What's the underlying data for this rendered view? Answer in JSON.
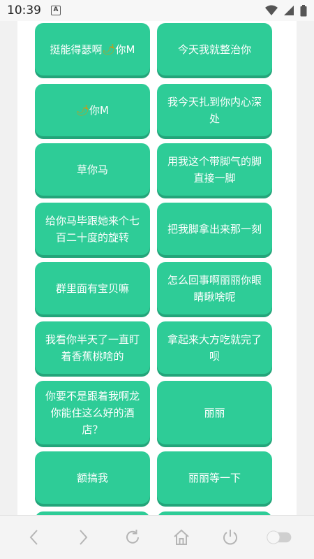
{
  "status": {
    "time": "10:39",
    "notify_icon": "a-notification-icon"
  },
  "buttons": [
    {
      "label": "挺能得瑟啊",
      "pepper": "🌶",
      "suffix": "你M"
    },
    {
      "label": "今天我就整治你"
    },
    {
      "label": "",
      "pepper": "🌶",
      "suffix": "你M"
    },
    {
      "label": "我今天扎到你内心深处"
    },
    {
      "label": "草你马"
    },
    {
      "label": "用我这个带脚气的脚直接一脚"
    },
    {
      "label": "给你马毕跟她来个七百二十度的旋转"
    },
    {
      "label": "把我脚拿出来那一刻"
    },
    {
      "label": "群里面有宝贝嘛"
    },
    {
      "label": "怎么回事啊丽丽你眼睛瞅啥呢"
    },
    {
      "label": "我看你半天了一直盯着香蕉桃啥的"
    },
    {
      "label": "拿起来大方吃就完了呗"
    },
    {
      "label": "你要不是跟着我啊龙你能住这么好的酒店？"
    },
    {
      "label": "丽丽"
    },
    {
      "label": "额搞我"
    },
    {
      "label": "丽丽等一下"
    },
    {
      "label": ""
    },
    {
      "label": ""
    }
  ],
  "navbar": {
    "icons": [
      "back-icon",
      "forward-icon",
      "refresh-icon",
      "home-icon",
      "power-icon",
      "toggle-switch"
    ]
  }
}
